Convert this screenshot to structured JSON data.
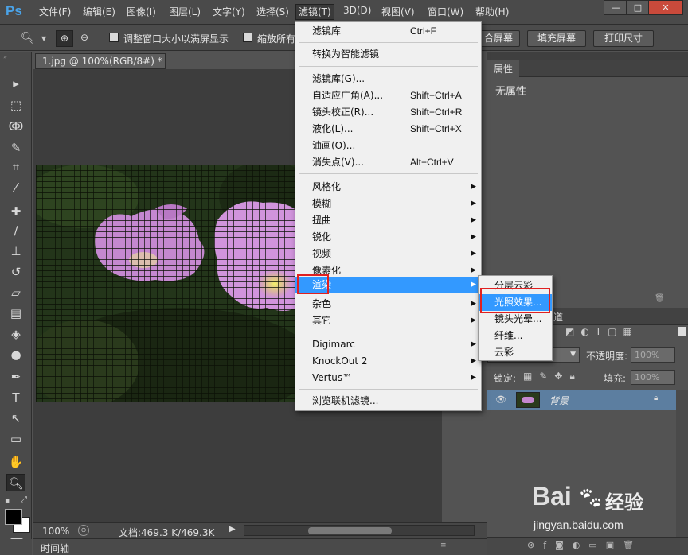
{
  "app": {
    "logo": "Ps"
  },
  "menubar": {
    "items": [
      "文件(F)",
      "编辑(E)",
      "图像(I)",
      "图层(L)",
      "文字(Y)",
      "选择(S)",
      "滤镜(T)",
      "3D(D)",
      "视图(V)",
      "窗口(W)",
      "帮助(H)"
    ],
    "active": "滤镜(T)"
  },
  "window_controls": {
    "minimize": "—",
    "maximize": "□",
    "close": "✕"
  },
  "options_bar": {
    "resize_window_label": "调整窗口大小以满屏显示",
    "zoom_all_label": "缩放所有",
    "fit_screen_label": "合屏幕",
    "fill_screen_label": "填充屏幕",
    "print_size_label": "打印尺寸"
  },
  "document": {
    "tab_title": "1.jpg @ 100%(RGB/8#) *",
    "tab_close": "×"
  },
  "status": {
    "zoom": "100%",
    "doc_info": "文档:469.3 K/469.3K"
  },
  "timeline": {
    "label": "时间轴"
  },
  "properties_panel": {
    "title": "属性",
    "content": "无属性"
  },
  "layers_panel": {
    "tab_label": "道",
    "opacity_label": "不透明度:",
    "opacity_value": "100%",
    "lock_label": "锁定:",
    "fill_label": "填充:",
    "fill_value": "100%",
    "layer_name": "背景"
  },
  "filter_menu": {
    "groups": [
      [
        {
          "label": "滤镜库",
          "shortcut": "Ctrl+F"
        }
      ],
      [
        {
          "label": "转换为智能滤镜",
          "shortcut": ""
        }
      ],
      [
        {
          "label": "滤镜库(G)...",
          "shortcut": ""
        },
        {
          "label": "自适应广角(A)...",
          "shortcut": "Shift+Ctrl+A"
        },
        {
          "label": "镜头校正(R)...",
          "shortcut": "Shift+Ctrl+R"
        },
        {
          "label": "液化(L)...",
          "shortcut": "Shift+Ctrl+X"
        },
        {
          "label": "油画(O)...",
          "shortcut": ""
        },
        {
          "label": "消失点(V)...",
          "shortcut": "Alt+Ctrl+V"
        }
      ],
      [
        {
          "label": "风格化",
          "submenu": true
        },
        {
          "label": "模糊",
          "submenu": true
        },
        {
          "label": "扭曲",
          "submenu": true
        },
        {
          "label": "锐化",
          "submenu": true
        },
        {
          "label": "视频",
          "submenu": true
        },
        {
          "label": "像素化",
          "submenu": true
        },
        {
          "label": "渲染",
          "submenu": true,
          "highlighted": true
        },
        {
          "label": "杂色",
          "submenu": true
        },
        {
          "label": "其它",
          "submenu": true
        }
      ],
      [
        {
          "label": "Digimarc",
          "submenu": true
        },
        {
          "label": "KnockOut 2",
          "submenu": true
        },
        {
          "label": "Vertus™",
          "submenu": true
        }
      ],
      [
        {
          "label": "浏览联机滤镜...",
          "shortcut": ""
        }
      ]
    ]
  },
  "render_submenu": {
    "items": [
      {
        "label": "分层云彩"
      },
      {
        "label": "光照效果...",
        "highlighted": true
      },
      {
        "label": "镜头光晕..."
      },
      {
        "label": "纤维..."
      },
      {
        "label": "云彩"
      }
    ]
  },
  "watermark": {
    "brand": "Bai",
    "brand2": "经验",
    "url": "jingyan.baidu.com"
  },
  "colors": {
    "menu_highlight": "#3399ff",
    "annotation_red": "#e02020",
    "ps_blue": "#4aa3e8"
  }
}
